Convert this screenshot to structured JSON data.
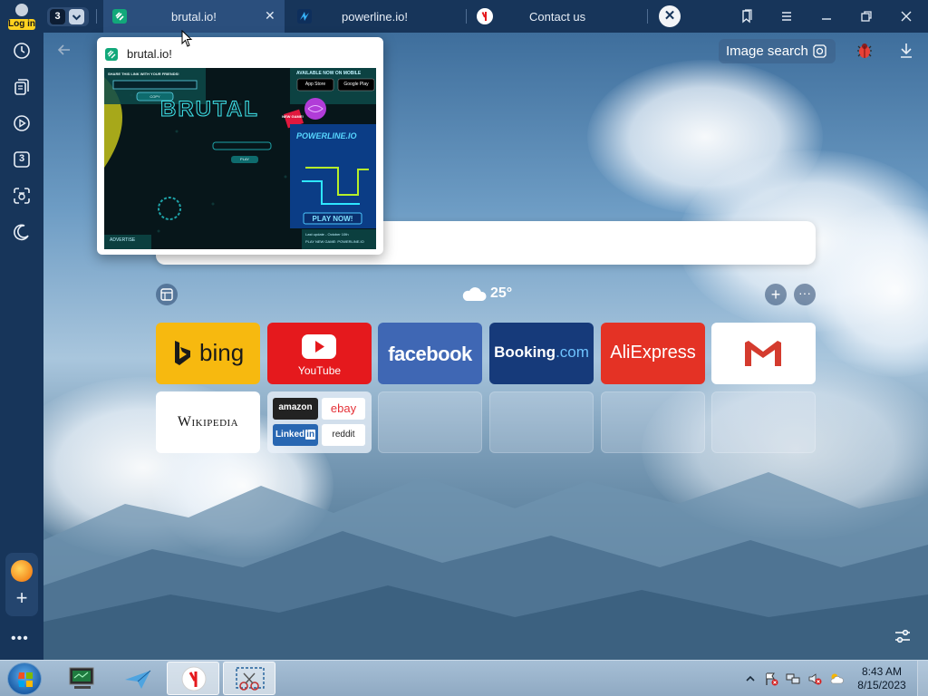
{
  "profile": {
    "login_label": "Log in"
  },
  "tab_counter": {
    "count": "3"
  },
  "tabs": [
    {
      "label": "brutal.io!",
      "active": true
    },
    {
      "label": "powerline.io!"
    },
    {
      "label": "Contact us"
    }
  ],
  "toolbar": {
    "image_search_label": "Image search"
  },
  "sidebar": {
    "items": [
      "history-icon",
      "collections-icon",
      "video-icon",
      "tabs-count-icon",
      "screenshot-icon",
      "night-mode-icon"
    ],
    "tabs_count": "3"
  },
  "weather": {
    "temp": "25°"
  },
  "tiles": [
    {
      "label": "bing",
      "bg": "#f7b90f"
    },
    {
      "label": "YouTube",
      "bg": "#e5191d"
    },
    {
      "label": "facebook",
      "bg": "#3f67b4"
    },
    {
      "label": "Booking.com",
      "bg": "#163a7a"
    },
    {
      "label": "AliExpress",
      "bg": "#e43225"
    },
    {
      "label": "Gmail",
      "bg": "#ffffff"
    },
    {
      "label": "Wikipedia",
      "bg": "#ffffff"
    },
    {
      "label": "Group",
      "sub": [
        "amazon",
        "ebay",
        "Linked in",
        "reddit"
      ]
    }
  ],
  "tile_text": {
    "bing": "bing",
    "youtube": "YouTube",
    "facebook": "facebook",
    "booking": "Booking",
    "booking_dot": ".com",
    "aliexpress": "AliExpress",
    "wikipedia": "Wikipedia",
    "amazon": "amazon",
    "ebay": "ebay",
    "linkedin": "Linked",
    "linkedin_in": "in",
    "reddit": "reddit"
  },
  "preview": {
    "title": "brutal.io!",
    "share_text": "SHARE THIS LINK WITH YOUR FRIENDS!",
    "copy_label": "COPY",
    "available_text": "AVAILABLE NOW ON MOBILE",
    "app_store": "App Store",
    "google_play": "Google Play",
    "game_logo": "BRUTAL",
    "badge": "NEW GAME!",
    "powerline_logo": "POWERLINE.IO",
    "play_now": "PLAY NOW!",
    "play_label": "PLAY",
    "advertise": "ADVERTISE",
    "footer_text": "Last update - October 10th",
    "footer_text2": "PLAY NEW GAME: POWERLINE.IO"
  },
  "taskbar": {
    "time": "8:43 AM",
    "date": "8/15/2023"
  },
  "colors": {
    "frame": "#17355a",
    "active_tab": "#2b4f7d",
    "accent_yellow": "#ffd21f",
    "taskbar": "#9bb5ce"
  }
}
